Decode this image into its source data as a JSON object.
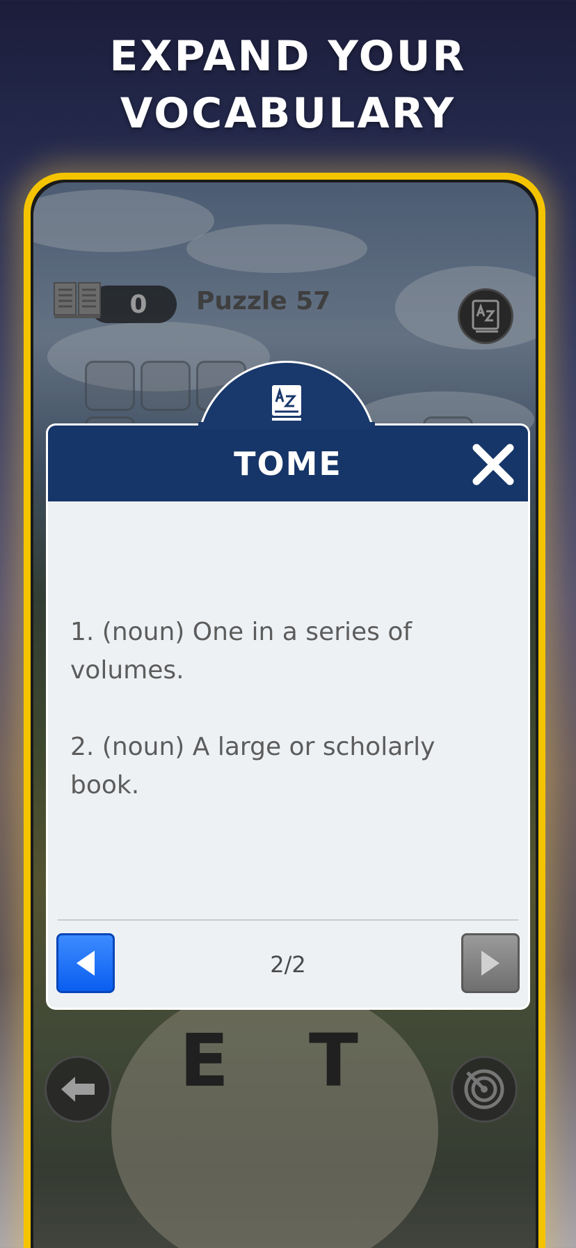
{
  "promo": {
    "headline_line1": "EXPAND YOUR",
    "headline_line2": "VOCABULARY"
  },
  "game": {
    "score": "0",
    "puzzle_label": "Puzzle 57",
    "wheel_letters": [
      "E",
      "T"
    ]
  },
  "dialog": {
    "word": "TOME",
    "definitions": [
      "1. (noun) One in a series of volumes.",
      "2. (noun) A large or scholarly book."
    ],
    "page_indicator": "2/2"
  },
  "icons": {
    "book": "book-icon",
    "dictionary": "dictionary-az-icon",
    "close": "close-icon",
    "prev": "triangle-left-icon",
    "next": "triangle-right-icon",
    "back": "arrow-left-icon",
    "target": "target-icon"
  },
  "colors": {
    "frame": "#f5c400",
    "dialog_header": "#163568",
    "prev_button": "#0a5ef0",
    "next_button": "#6f6f6f"
  }
}
